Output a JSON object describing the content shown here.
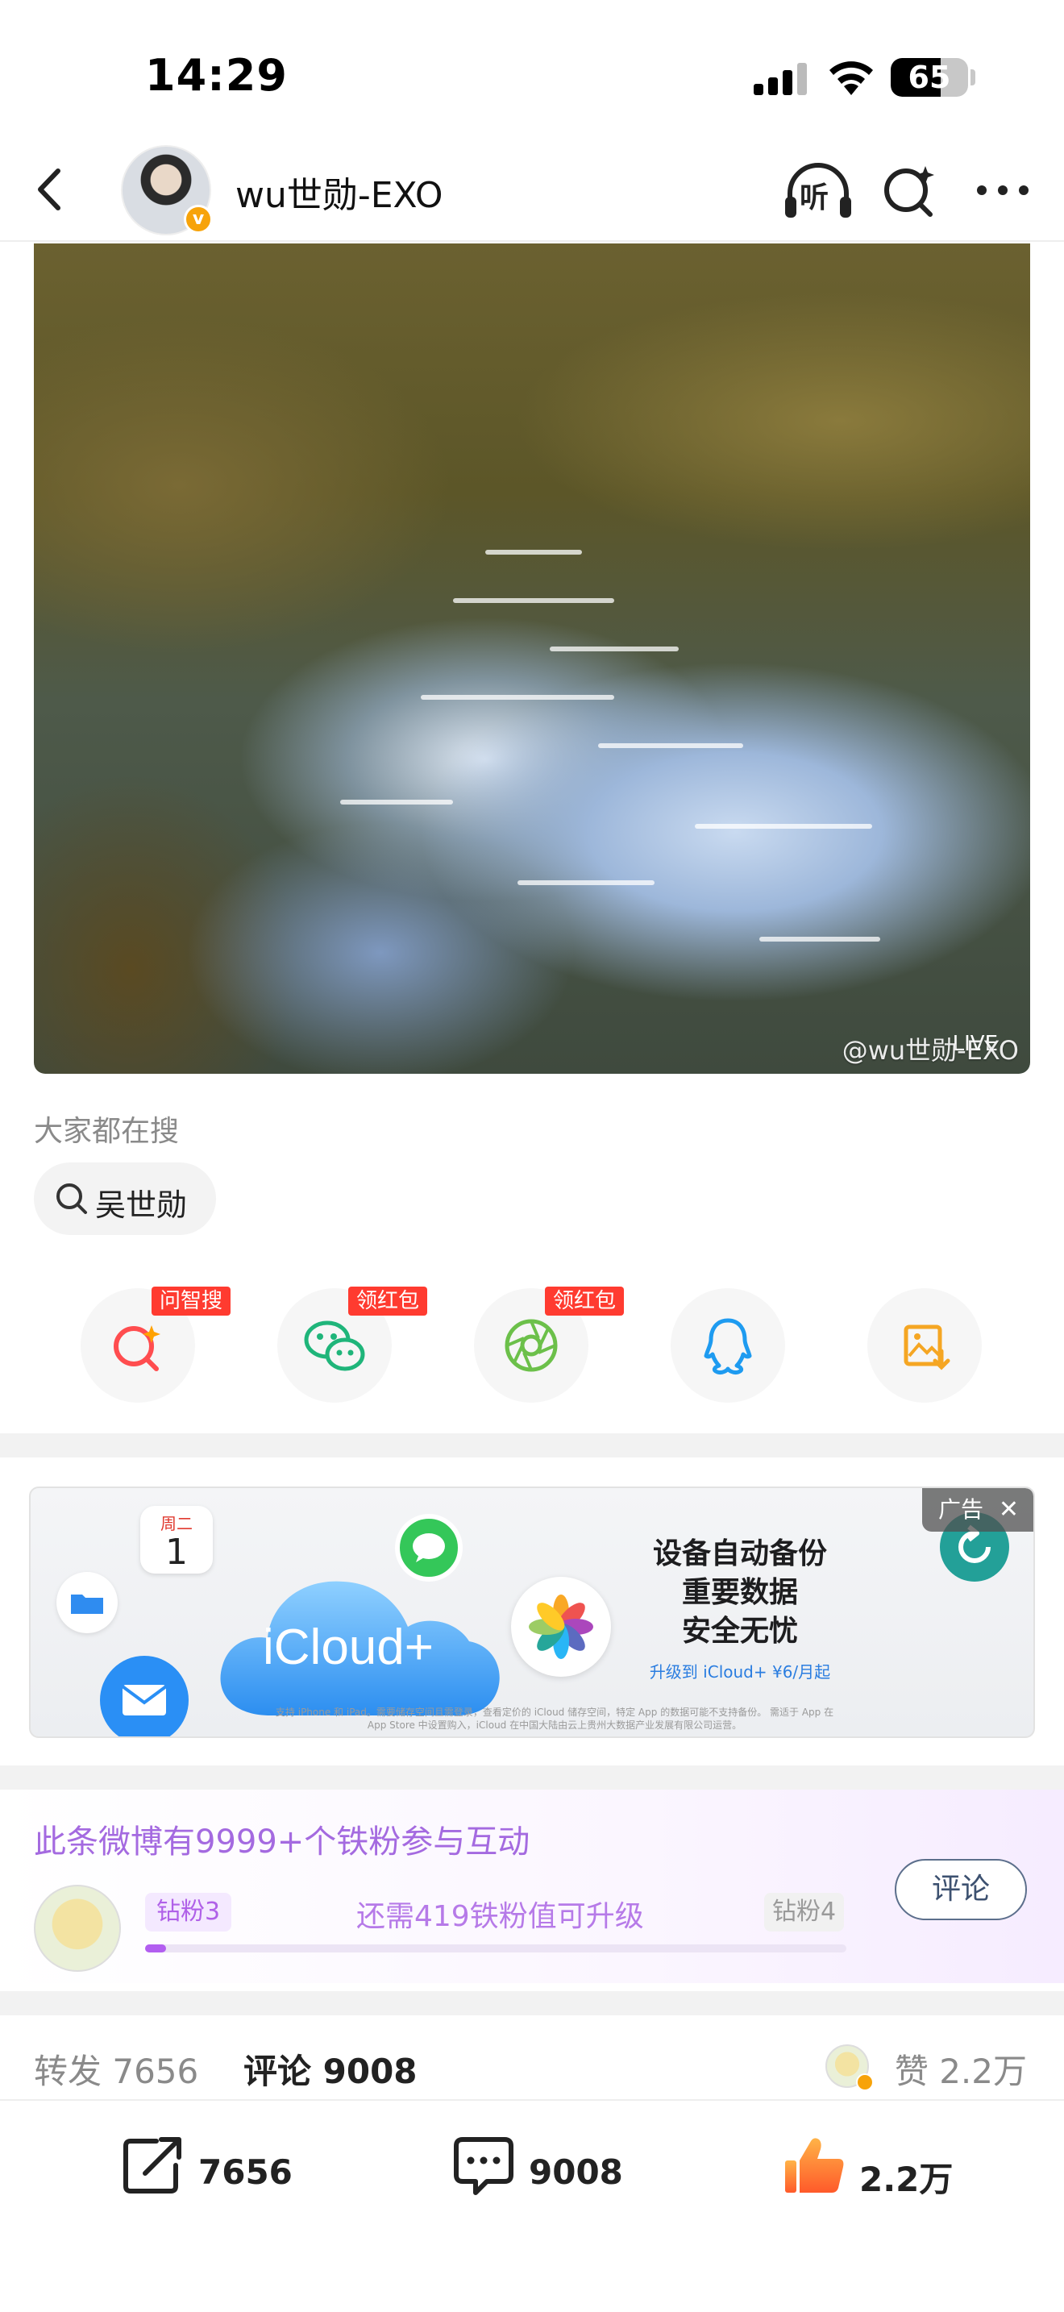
{
  "status_bar": {
    "time": "14:29",
    "battery": "65",
    "battery_level": 0.65
  },
  "header": {
    "title": "wu世勋-EXO",
    "listen_label": "听"
  },
  "photo": {
    "watermark": "@wu世勋-EXO",
    "live_badge": "LIVE"
  },
  "search": {
    "heading": "大家都在搜",
    "chip": "吴世勋"
  },
  "share": {
    "tags": [
      "问智搜",
      "领红包",
      "领红包"
    ],
    "icons": [
      "ai-search-icon",
      "wechat-icon",
      "moments-icon",
      "qq-icon",
      "save-image-icon"
    ]
  },
  "ad": {
    "label": "广告",
    "calendar_day": "周二",
    "calendar_num": "1",
    "cloud_text": "iCloud+",
    "headline_lines": [
      "设备自动备份",
      "重要数据",
      "安全无忧"
    ],
    "sub": "升级到 iCloud+ ¥6/月起",
    "fine_print": "支持 iPhone 和 iPad。需要储存空间且需登录，查看定价的 iCloud 储存空间，特定 App 的数据可能不支持备份。 需适于 App 在 App Store 中设置购入，iCloud 在中国大陆由云上贵州大数据产业发展有限公司运营。"
  },
  "fan": {
    "title": "此条微博有9999+个铁粉参与互动",
    "level_left": "钻粉3",
    "level_right": "钻粉4",
    "message": "还需419铁粉值可升级",
    "progress": 0.03,
    "comment_button": "评论"
  },
  "counts": {
    "repost": "转发 7656",
    "comment": "评论 9008",
    "like": "赞 2.2万"
  },
  "bottom_bar": {
    "repost": "7656",
    "comment": "9008",
    "like": "2.2万"
  },
  "colors": {
    "accent_purple": "#a46ae0",
    "like_orange": "#ff8a00",
    "tag_red": "#ff3b30"
  }
}
